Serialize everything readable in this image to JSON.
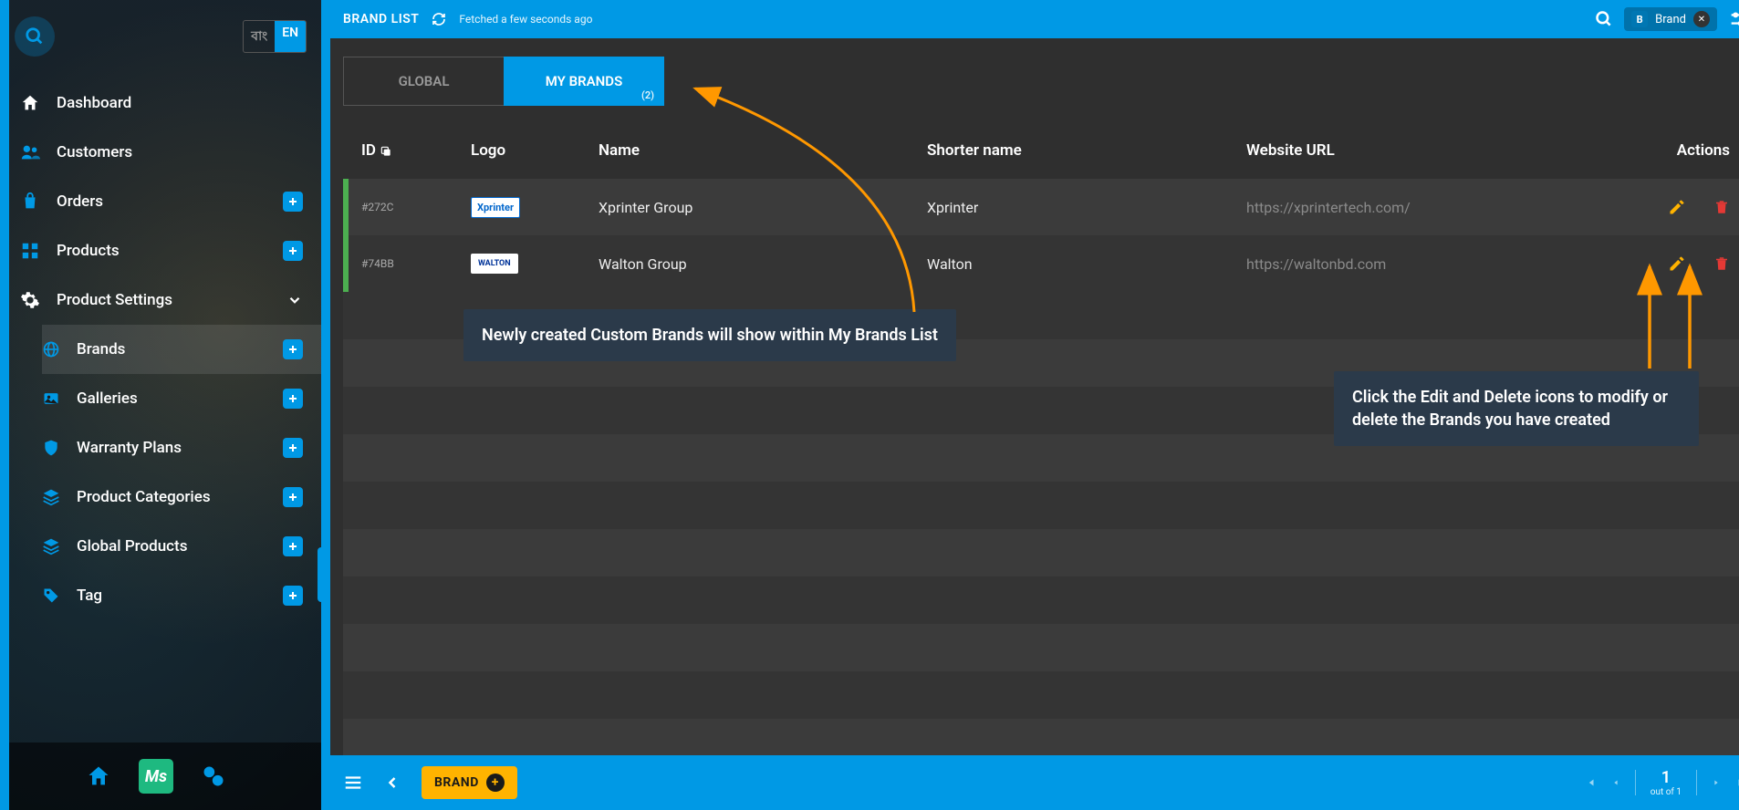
{
  "sidebar": {
    "lang_a": "বাং",
    "lang_b": "EN",
    "items": [
      {
        "label": "Dashboard"
      },
      {
        "label": "Customers"
      },
      {
        "label": "Orders"
      },
      {
        "label": "Products"
      },
      {
        "label": "Product Settings"
      }
    ],
    "sub_items": [
      {
        "label": "Brands"
      },
      {
        "label": "Galleries"
      },
      {
        "label": "Warranty Plans"
      },
      {
        "label": "Product Categories"
      },
      {
        "label": "Global Products"
      },
      {
        "label": "Tag"
      }
    ]
  },
  "header": {
    "title": "BRAND LIST",
    "status": "Fetched a few seconds ago",
    "chip_letter": "B",
    "chip_text": "Brand"
  },
  "tabs": {
    "global": "GLOBAL",
    "mybrands": "MY BRANDS",
    "count": "(2)"
  },
  "table": {
    "headers": {
      "id": "ID",
      "logo": "Logo",
      "name": "Name",
      "shorter": "Shorter name",
      "url": "Website URL",
      "actions": "Actions"
    },
    "rows": [
      {
        "id": "#272C",
        "logo_text": "Xprinter",
        "name": "Xprinter Group",
        "shorter": "Xprinter",
        "url": "https://xprintertech.com/"
      },
      {
        "id": "#74BB",
        "logo_text": "WALTON",
        "name": "Walton Group",
        "shorter": "Walton",
        "url": "https://waltonbd.com"
      }
    ]
  },
  "callouts": {
    "c1": "Newly created Custom Brands will show within My Brands List",
    "c2": "Click the Edit and Delete icons to modify or delete the Brands you have created"
  },
  "footer": {
    "brand_btn": "BRAND",
    "page_num": "1",
    "page_of": "out of 1"
  },
  "icons": {
    "search": "search-icon",
    "home": "home-icon",
    "users": "users-icon",
    "bag": "bag-icon",
    "grid": "grid-icon",
    "gear": "gear-icon",
    "globe": "globe-icon",
    "gallery": "gallery-icon",
    "shield": "shield-icon",
    "layers": "layers-icon",
    "tag": "tag-icon",
    "plus": "plus-icon",
    "edit": "edit-icon",
    "delete": "delete-icon",
    "refresh": "refresh-icon",
    "menu": "menu-icon",
    "chevleft": "chevron-left-icon",
    "chevdown": "chevron-down-icon",
    "close": "close-icon",
    "gear-un": "gear-union-icon",
    "copy": "copy-icon",
    "tune": "tune-icon"
  }
}
